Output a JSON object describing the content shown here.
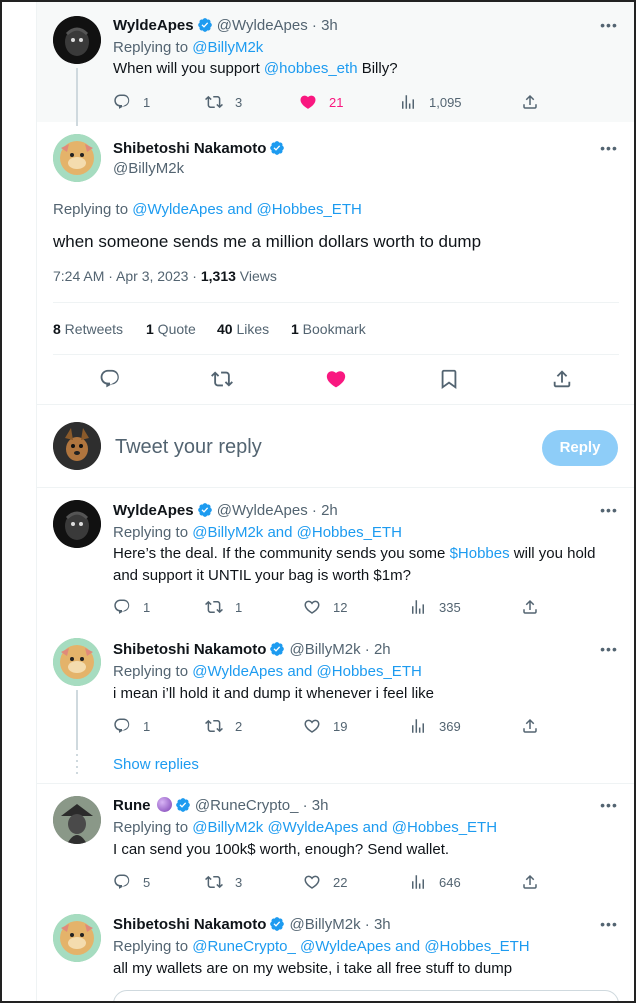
{
  "colors": {
    "link": "#1d9bf0",
    "muted": "#536471",
    "like": "#f91880",
    "reply_btn": "#8ecdf8"
  },
  "tweet0": {
    "name": "WyldeApes",
    "handle": "@WyldeApes",
    "time": "· 3h",
    "replying_prefix": "Replying to",
    "replying_to": "@BillyM2k",
    "text_a": "When will you support ",
    "text_link": "@hobbes_eth",
    "text_b": " Billy?",
    "replies": "1",
    "retweets": "3",
    "likes": "21",
    "views": "1,095"
  },
  "main": {
    "name": "Shibetoshi Nakamoto",
    "handle": "@BillyM2k",
    "replying_prefix": "Replying to",
    "replying_to": "@WyldeApes and @Hobbes_ETH",
    "text": "when someone sends me a million dollars worth to dump",
    "timestamp": "7:24 AM · Apr 3, 2023 · ",
    "views_count": "1,313",
    "views_label": " Views",
    "retweets_count": "8",
    "retweets_label": " Retweets",
    "quotes_count": "1",
    "quotes_label": " Quote",
    "likes_count": "40",
    "likes_label": " Likes",
    "bookmarks_count": "1",
    "bookmarks_label": " Bookmark"
  },
  "compose": {
    "placeholder": "Tweet your reply",
    "button": "Reply"
  },
  "reply1": {
    "name": "WyldeApes",
    "handle": "@WyldeApes",
    "time": "· 2h",
    "replying_prefix": "Replying to",
    "replying_to": "@BillyM2k and @Hobbes_ETH",
    "text_a": "Here’s the deal. If the community sends you some ",
    "text_link": "$Hobbes",
    "text_b": " will you hold and support it UNTIL your bag is worth $1m?",
    "replies": "1",
    "retweets": "1",
    "likes": "12",
    "views": "335"
  },
  "reply2": {
    "name": "Shibetoshi Nakamoto",
    "handle": "@BillyM2k",
    "time": "· 2h",
    "replying_prefix": "Replying to",
    "replying_to": "@WyldeApes and @Hobbes_ETH",
    "text": "i mean i’ll hold it and dump it whenever i feel like",
    "replies": "1",
    "retweets": "2",
    "likes": "19",
    "views": "369"
  },
  "show_replies": "Show replies",
  "reply3": {
    "name": "Rune",
    "handle": "@RuneCrypto_",
    "time": "· 3h",
    "replying_prefix": "Replying to",
    "replying_to": "@BillyM2k @WyldeApes and @Hobbes_ETH",
    "text": "I can send you 100k$ worth, enough? Send wallet.",
    "replies": "5",
    "retweets": "3",
    "likes": "22",
    "views": "646"
  },
  "reply4": {
    "name": "Shibetoshi Nakamoto",
    "handle": "@BillyM2k",
    "time": "· 3h",
    "replying_prefix": "Replying to",
    "replying_to": "@RuneCrypto_ @WyldeApes and @Hobbes_ETH",
    "text": "all my wallets are on my website, i take all free stuff to dump"
  }
}
